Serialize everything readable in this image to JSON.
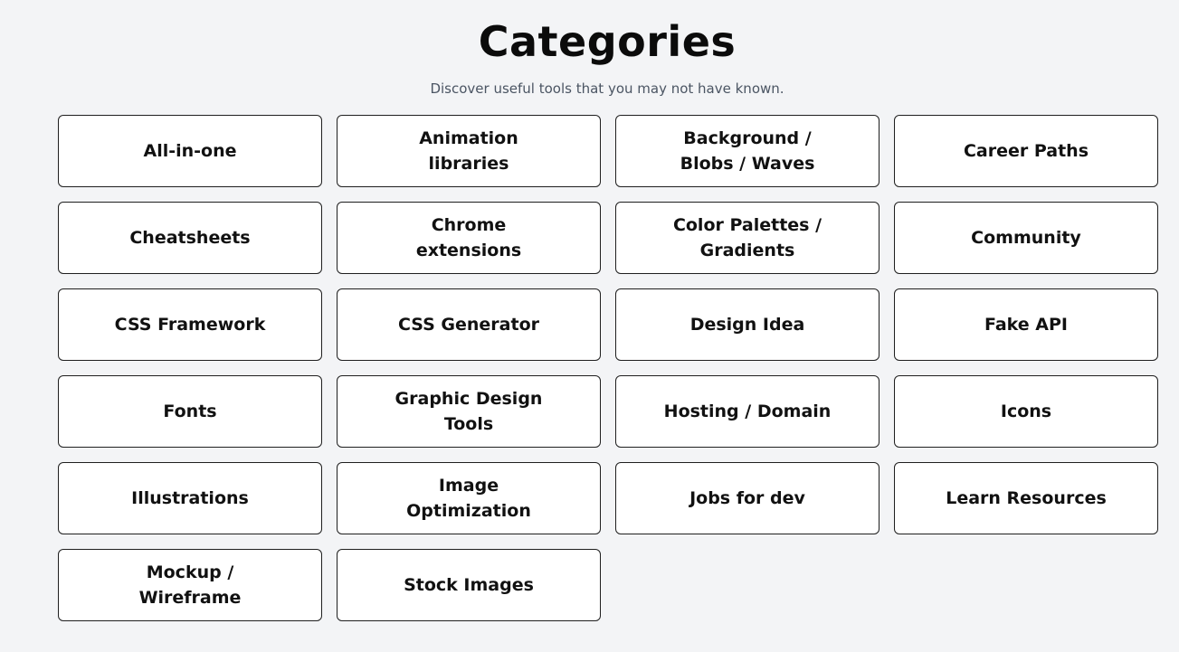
{
  "header": {
    "title": "Categories",
    "subtitle": "Discover useful tools that you may not have known."
  },
  "categories": [
    {
      "label": "All-in-one"
    },
    {
      "label": "Animation libraries"
    },
    {
      "label": "Background / Blobs / Waves"
    },
    {
      "label": "Career Paths"
    },
    {
      "label": "Cheatsheets"
    },
    {
      "label": "Chrome extensions"
    },
    {
      "label": "Color Palettes / Gradients"
    },
    {
      "label": "Community"
    },
    {
      "label": "CSS Framework"
    },
    {
      "label": "CSS Generator"
    },
    {
      "label": "Design Idea"
    },
    {
      "label": "Fake API"
    },
    {
      "label": "Fonts"
    },
    {
      "label": "Graphic Design Tools"
    },
    {
      "label": "Hosting / Domain"
    },
    {
      "label": "Icons"
    },
    {
      "label": "Illustrations"
    },
    {
      "label": "Image Optimization"
    },
    {
      "label": "Jobs for dev"
    },
    {
      "label": "Learn Resources"
    },
    {
      "label": "Mockup / Wireframe"
    },
    {
      "label": "Stock Images"
    }
  ],
  "colors": {
    "background": "#f3f4f6",
    "card_background": "#ffffff",
    "card_border": "#1f1f1f",
    "title": "#0b0b0b",
    "subtitle": "#4b5563"
  }
}
